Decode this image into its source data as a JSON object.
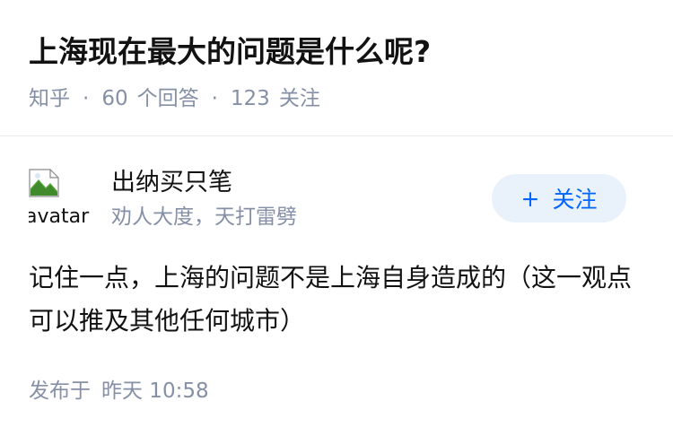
{
  "question": {
    "title": "上海现在最大的问题是什么呢?",
    "source": "知乎",
    "separator": "·",
    "answer_count": "60",
    "answer_label": "个回答",
    "follower_count": "123",
    "follower_label": "关注"
  },
  "author": {
    "avatar_alt": "avatar",
    "avatar_icon": "broken-image-icon",
    "name": "出纳买只笔",
    "bio": "劝人大度，天打雷劈",
    "follow_plus": "+",
    "follow_label": "关注"
  },
  "answer": {
    "content": "记住一点，上海的问题不是上海自身造成的（这一观点可以推及其他任何城市）",
    "published_label": "发布于",
    "published_time": "昨天 10:58"
  },
  "colors": {
    "muted": "#8590a6",
    "accent": "#0066ff",
    "follow_bg": "#e9f1fb"
  }
}
